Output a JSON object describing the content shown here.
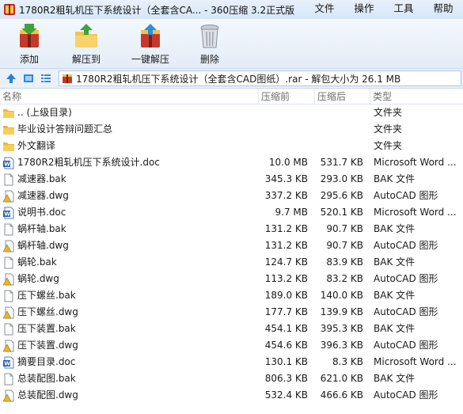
{
  "window": {
    "title": "1780R2粗轧机压下系统设计（全套含CA... - 360压缩 3.2正式版"
  },
  "menu": [
    "文件",
    "操作",
    "工具",
    "帮助"
  ],
  "toolbar": {
    "add": "添加",
    "extract_to": "解压到",
    "one_click_extract": "一键解压",
    "delete": "删除"
  },
  "address": {
    "path": "1780R2粗轧机压下系统设计（全套含CAD图纸）.rar - 解包大小为 26.1 MB"
  },
  "columns": {
    "name": "名称",
    "size": "压缩前",
    "packed": "压缩后",
    "type": "类型"
  },
  "files": [
    {
      "icon": "folder-up-icon",
      "name": ".. (上级目录)",
      "size": "",
      "packed": "",
      "type": "文件夹"
    },
    {
      "icon": "folder-icon",
      "name": "毕业设计答辩问题汇总",
      "size": "",
      "packed": "",
      "type": "文件夹"
    },
    {
      "icon": "folder-icon",
      "name": "外文翻译",
      "size": "",
      "packed": "",
      "type": "文件夹"
    },
    {
      "icon": "word-doc-icon",
      "name": "1780R2粗轧机压下系统设计.doc",
      "size": "10.0 MB",
      "packed": "531.7 KB",
      "type": "Microsoft Word ..."
    },
    {
      "icon": "bak-file-icon",
      "name": "减速器.bak",
      "size": "345.3 KB",
      "packed": "293.0 KB",
      "type": "BAK 文件"
    },
    {
      "icon": "dwg-file-icon",
      "name": "减速器.dwg",
      "size": "337.2 KB",
      "packed": "295.6 KB",
      "type": "AutoCAD 图形"
    },
    {
      "icon": "word-doc-icon",
      "name": "说明书.doc",
      "size": "9.7 MB",
      "packed": "520.1 KB",
      "type": "Microsoft Word ..."
    },
    {
      "icon": "bak-file-icon",
      "name": "蜗杆轴.bak",
      "size": "131.2 KB",
      "packed": "90.7 KB",
      "type": "BAK 文件"
    },
    {
      "icon": "dwg-file-icon",
      "name": "蜗杆轴.dwg",
      "size": "131.2 KB",
      "packed": "90.7 KB",
      "type": "AutoCAD 图形"
    },
    {
      "icon": "bak-file-icon",
      "name": "蜗轮.bak",
      "size": "124.7 KB",
      "packed": "83.9 KB",
      "type": "BAK 文件"
    },
    {
      "icon": "dwg-file-icon",
      "name": "蜗轮.dwg",
      "size": "113.2 KB",
      "packed": "83.2 KB",
      "type": "AutoCAD 图形"
    },
    {
      "icon": "bak-file-icon",
      "name": "压下螺丝.bak",
      "size": "189.0 KB",
      "packed": "140.0 KB",
      "type": "BAK 文件"
    },
    {
      "icon": "dwg-file-icon",
      "name": "压下螺丝.dwg",
      "size": "177.7 KB",
      "packed": "139.9 KB",
      "type": "AutoCAD 图形"
    },
    {
      "icon": "bak-file-icon",
      "name": "压下装置.bak",
      "size": "454.1 KB",
      "packed": "395.3 KB",
      "type": "BAK 文件"
    },
    {
      "icon": "dwg-file-icon",
      "name": "压下装置.dwg",
      "size": "454.6 KB",
      "packed": "396.3 KB",
      "type": "AutoCAD 图形"
    },
    {
      "icon": "word-doc-icon",
      "name": "摘要目录.doc",
      "size": "130.1 KB",
      "packed": "8.3 KB",
      "type": "Microsoft Word ..."
    },
    {
      "icon": "bak-file-icon",
      "name": "总装配图.bak",
      "size": "806.3 KB",
      "packed": "621.0 KB",
      "type": "BAK 文件"
    },
    {
      "icon": "dwg-file-icon",
      "name": "总装配图.dwg",
      "size": "532.4 KB",
      "packed": "466.6 KB",
      "type": "AutoCAD 图形"
    }
  ]
}
